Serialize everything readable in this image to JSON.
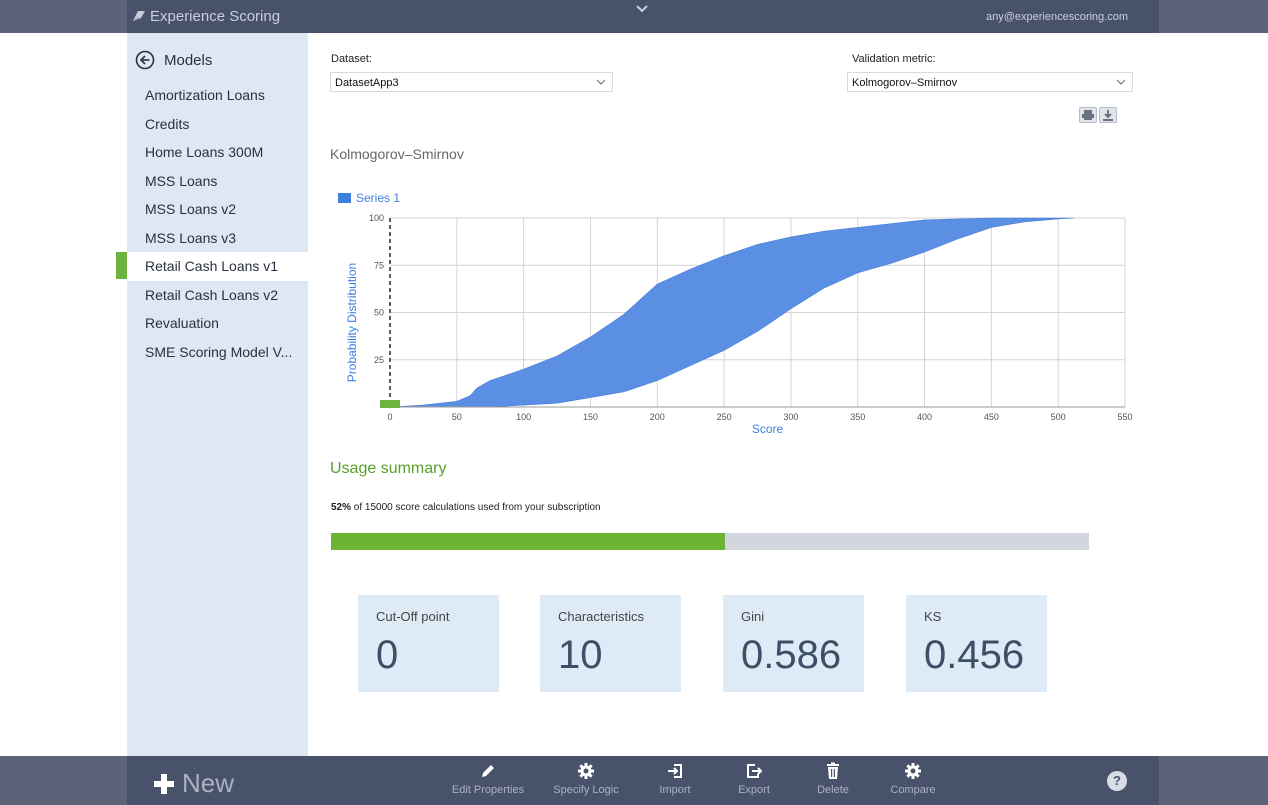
{
  "app": {
    "title": "Experience Scoring",
    "user_email": "any@experiencescoring.com"
  },
  "sidebar": {
    "back_label": "Models",
    "items": [
      {
        "label": "Amortization Loans"
      },
      {
        "label": "Credits"
      },
      {
        "label": "Home Loans 300M"
      },
      {
        "label": "MSS Loans"
      },
      {
        "label": "MSS Loans v2"
      },
      {
        "label": "MSS Loans v3"
      },
      {
        "label": "Retail Cash Loans v1",
        "active": true
      },
      {
        "label": "Retail Cash Loans v2"
      },
      {
        "label": "Revaluation"
      },
      {
        "label": "SME Scoring Model V..."
      }
    ]
  },
  "filters": {
    "dataset_label": "Dataset:",
    "dataset_value": "DatasetApp3",
    "metric_label": "Validation metric:",
    "metric_value": "Kolmogorov–Smirnov"
  },
  "chart_data": {
    "type": "area",
    "title": "Kolmogorov–Smirnov",
    "legend": [
      "Series 1"
    ],
    "legend_position": "top-left",
    "xlabel": "Score",
    "ylabel": "Probability Distribution",
    "xlim": [
      0,
      550
    ],
    "ylim": [
      0,
      100
    ],
    "x_ticks": [
      0,
      50,
      100,
      150,
      200,
      250,
      300,
      350,
      400,
      450,
      500,
      550
    ],
    "y_ticks": [
      25,
      50,
      75,
      100
    ],
    "grid": true,
    "series": [
      {
        "name": "Series 1",
        "color": "#5b8fe3",
        "x": [
          0,
          25,
          50,
          60,
          65,
          75,
          100,
          125,
          150,
          175,
          200,
          225,
          250,
          275,
          300,
          325,
          350,
          375,
          400,
          425,
          450,
          475,
          500,
          512
        ],
        "upper": [
          0,
          1,
          3,
          6,
          10,
          14,
          20,
          27,
          37,
          49,
          65,
          73,
          80,
          86,
          90,
          93,
          95,
          97,
          99,
          99.5,
          100,
          100,
          100,
          100
        ],
        "lower": [
          0,
          0,
          0,
          0,
          0,
          0,
          1,
          2,
          5,
          8,
          14,
          22,
          30,
          40,
          52,
          63,
          71,
          76,
          82,
          89,
          95,
          98,
          99.5,
          100
        ]
      }
    ],
    "cutoff_marker_x": 0
  },
  "usage": {
    "title": "Usage summary",
    "percent_text": "52%",
    "text": "of 15000 score calculations used from your subscription",
    "fraction": 0.52
  },
  "stats": [
    {
      "label": "Cut-Off point",
      "value": "0"
    },
    {
      "label": "Characteristics",
      "value": "10"
    },
    {
      "label": "Gini",
      "value": "0.586"
    },
    {
      "label": "KS",
      "value": "0.456"
    }
  ],
  "bottombar": {
    "new_label": "New",
    "edit": "Edit Properties",
    "logic": "Specify Logic",
    "import": "Import",
    "export": "Export",
    "delete": "Delete",
    "compare": "Compare",
    "help": "?"
  },
  "colors": {
    "accent_green": "#6db33f",
    "series_blue": "#5b8fe3",
    "topbar": "#48526a"
  },
  "icons": [
    "app-logo-icon",
    "chevron-down-icon",
    "back-arrow-icon",
    "print-icon",
    "download-icon",
    "plus-icon",
    "pencil-icon",
    "gear-icon",
    "import-icon",
    "export-icon",
    "trash-icon",
    "help-icon"
  ]
}
